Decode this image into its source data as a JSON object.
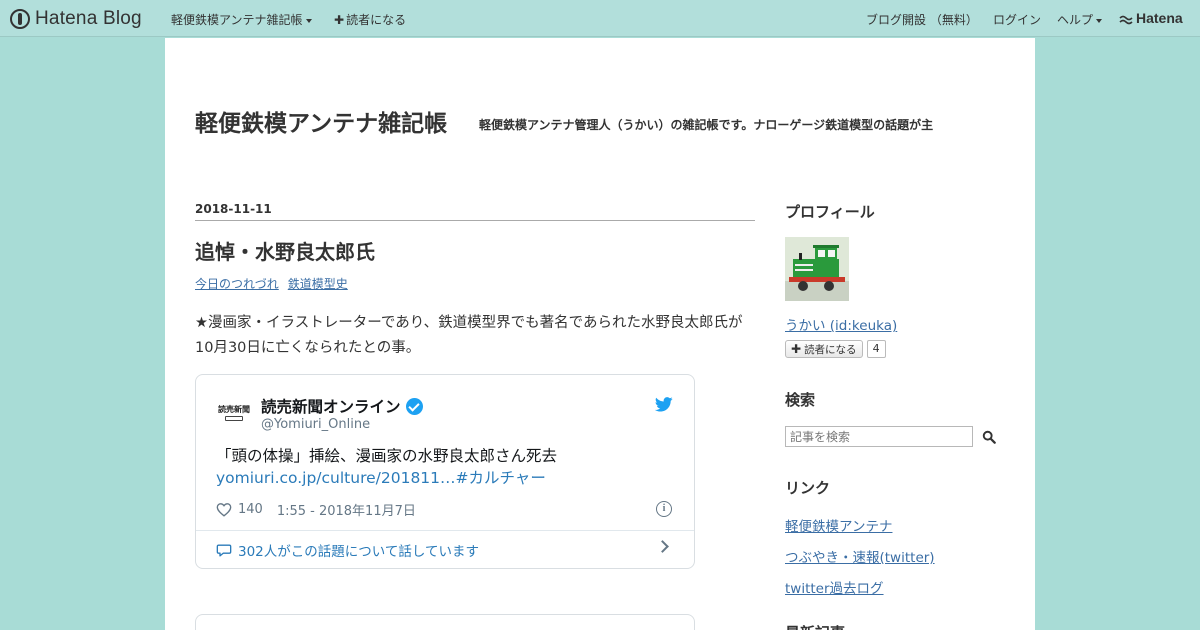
{
  "globalbar": {
    "logo_text": "Hatena Blog",
    "blog_menu": "軽便鉄模アンテナ雑記帳",
    "subscribe": "読者になる",
    "open_blog": "ブログ開設 （無料）",
    "login": "ログイン",
    "help": "ヘルプ",
    "hatena": "Hatena"
  },
  "header": {
    "title": "軽便鉄模アンテナ雑記帳",
    "description": "軽便鉄模アンテナ管理人（うかい）の雑記帳です。ナローゲージ鉄道模型の話題が主"
  },
  "entry": {
    "date": "2018-11-11",
    "title": "追悼・水野良太郎氏",
    "categories": [
      "今日のつれづれ",
      "鉄道模型史"
    ],
    "body": "★漫画家・イラストレーターであり、鉄道模型界でも著名であられた水野良太郎氏が10月30日に亡くなられたとの事。"
  },
  "tweet": {
    "avatar_text": "読売新聞",
    "name": "読売新聞オンライン",
    "handle": "@Yomiuri_Online",
    "text": "「頭の体操」挿絵、漫画家の水野良太郎さん死去",
    "link": "yomiuri.co.jp/culture/201811…#カルチャー",
    "likes": "140",
    "time": "1:55 - 2018年11月7日",
    "info": "i",
    "replies": "302人がこの話題について話しています"
  },
  "sidebar": {
    "profile_heading": "プロフィール",
    "profile_name": "うかい (id:keuka)",
    "follow_label": "読者になる",
    "follow_count": "4",
    "search_heading": "検索",
    "search_placeholder": "記事を検索",
    "links_heading": "リンク",
    "links": [
      "軽便鉄模アンテナ",
      "つぶやき・速報(twitter)",
      "twitter過去ログ"
    ],
    "recent_heading": "最新記事"
  },
  "colors": {
    "background": "#a8dcd6",
    "link": "#3b6ea5",
    "twitter_blue": "#1da1f2"
  }
}
